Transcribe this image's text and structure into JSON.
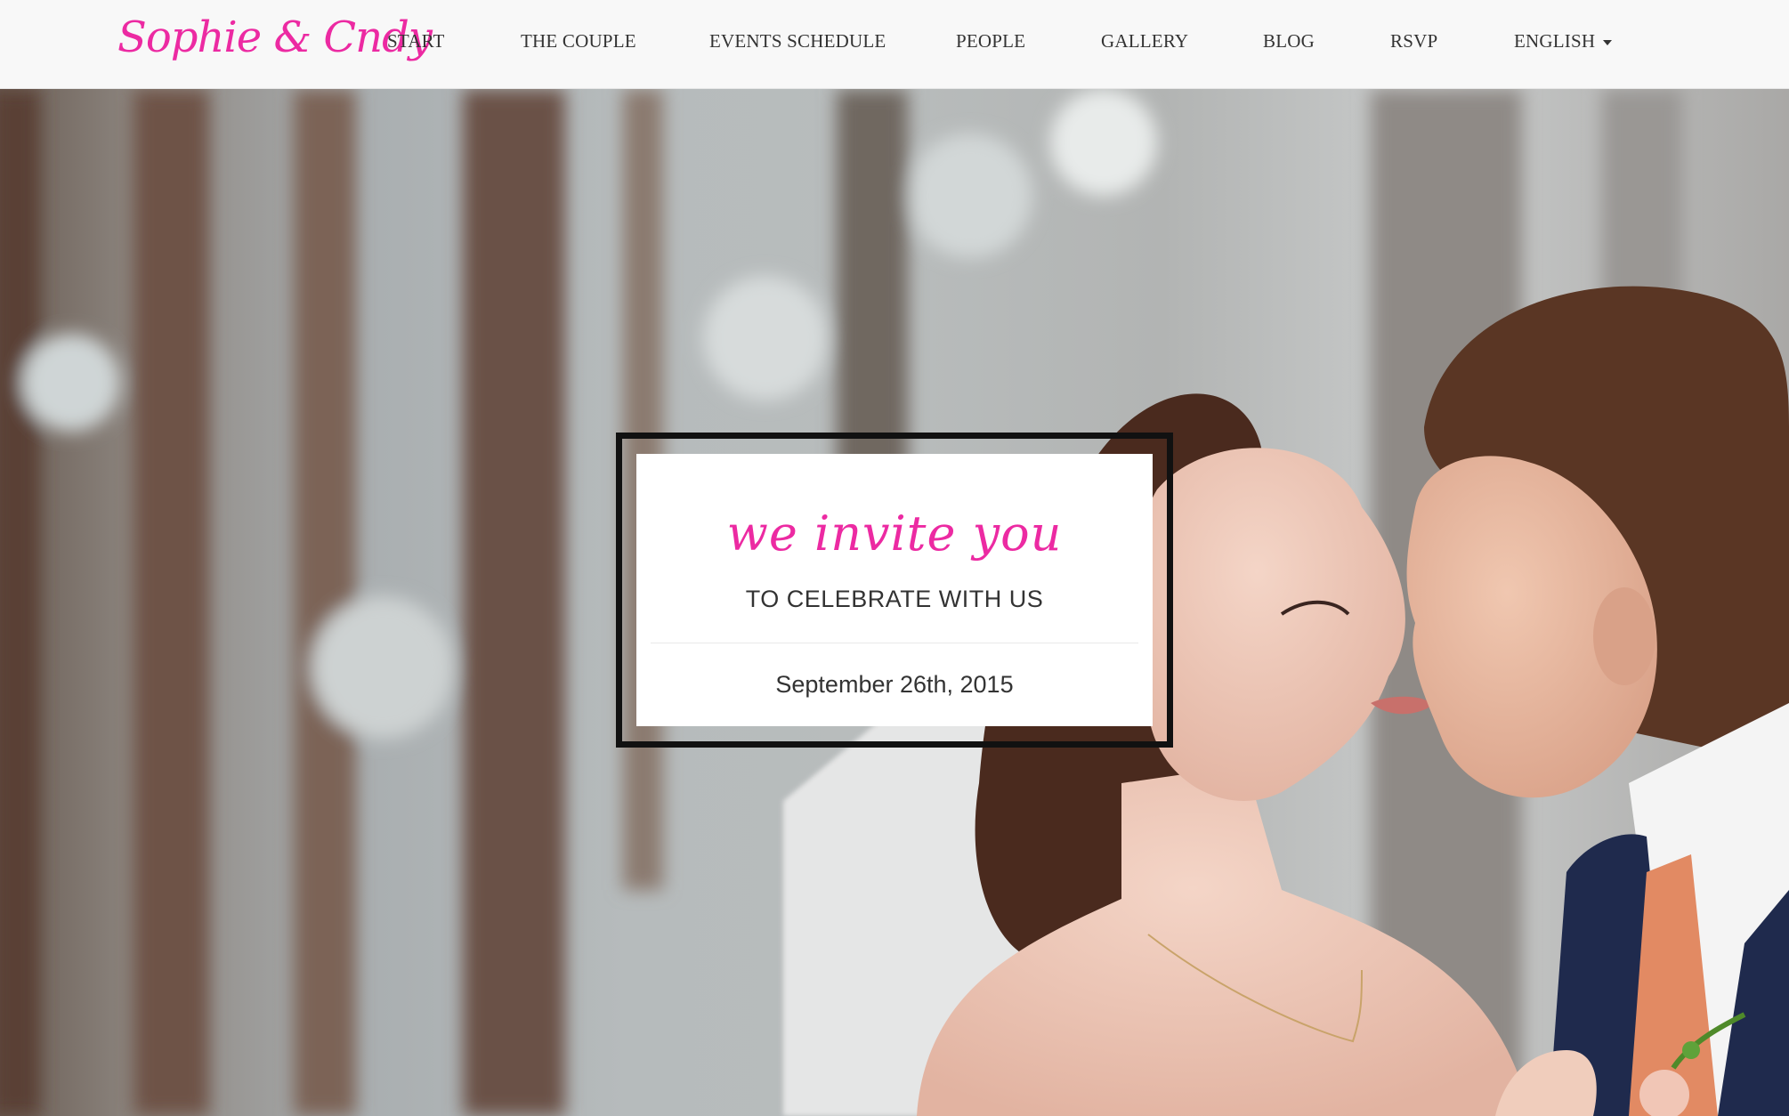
{
  "brand": {
    "name": "Sophie & Cndy",
    "color": "#ec2aa2"
  },
  "nav": {
    "items": [
      {
        "label": "START"
      },
      {
        "label": "THE COUPLE"
      },
      {
        "label": "EVENTS SCHEDULE"
      },
      {
        "label": "PEOPLE"
      },
      {
        "label": "GALLERY"
      },
      {
        "label": "BLOG"
      },
      {
        "label": "RSVP"
      }
    ],
    "language": {
      "label": "ENGLISH",
      "icon": "caret-down-icon"
    }
  },
  "hero": {
    "image": "wedding-couple-photo",
    "invitation": {
      "script_line": "we invite you",
      "subtitle": "TO CELEBRATE WITH US",
      "date": "September 26th, 2015"
    }
  }
}
